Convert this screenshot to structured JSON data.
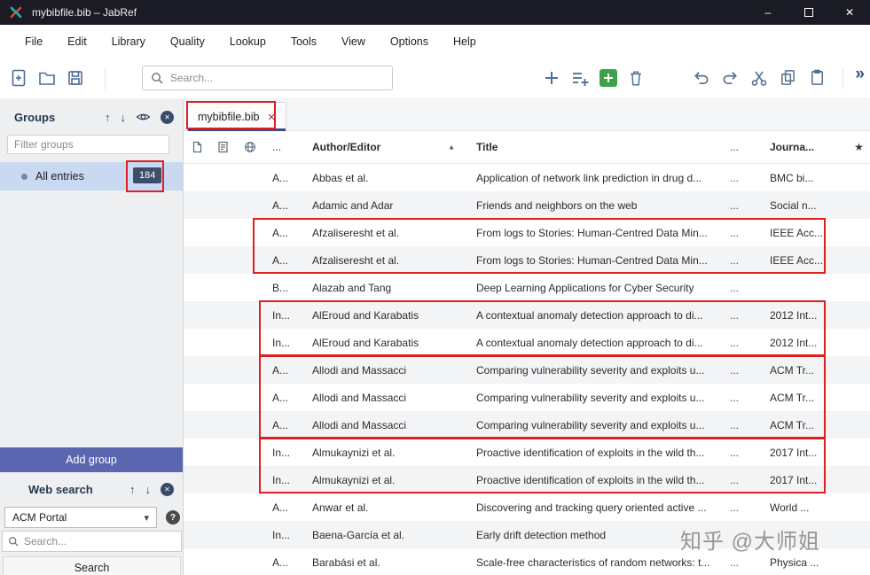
{
  "window": {
    "title": "mybibfile.bib – JabRef"
  },
  "icons": {
    "minimize": "–",
    "close": "✕",
    "help": "?",
    "dropdown": "▾",
    "up": "↑",
    "down": "↓",
    "overflow": "»",
    "sort_asc": "▲",
    "star": "★"
  },
  "menu": {
    "items": [
      "File",
      "Edit",
      "Library",
      "Quality",
      "Lookup",
      "Tools",
      "View",
      "Options",
      "Help"
    ]
  },
  "toolbar": {
    "search_placeholder": "Search..."
  },
  "sidebar": {
    "groups_header": "Groups",
    "filter_placeholder": "Filter groups",
    "all_entries_label": "All entries",
    "all_entries_count": "184",
    "add_group_label": "Add group",
    "web_search_header": "Web search",
    "engine_value": "ACM Portal",
    "search_placeholder": "Search...",
    "search_button_label": "Search"
  },
  "tab": {
    "label": "mybibfile.bib"
  },
  "table": {
    "headers": {
      "entrytype": "...",
      "author": "Author/Editor",
      "title": "Title",
      "dots": "...",
      "journal": "Journa..."
    },
    "rows": [
      {
        "type": "A...",
        "author": "Abbas et al.",
        "title": "Application of network link prediction in drug d...",
        "dots": "...",
        "journal": "BMC bi..."
      },
      {
        "type": "A...",
        "author": "Adamic and Adar",
        "title": "Friends and neighbors on the web",
        "dots": "...",
        "journal": "Social n..."
      },
      {
        "type": "A...",
        "author": "Afzaliseresht et al.",
        "title": "From logs to Stories: Human-Centred Data Min...",
        "dots": "...",
        "journal": "IEEE Acc..."
      },
      {
        "type": "A...",
        "author": "Afzaliseresht et al.",
        "title": "From logs to Stories: Human-Centred Data Min...",
        "dots": "...",
        "journal": "IEEE Acc..."
      },
      {
        "type": "B...",
        "author": "Alazab and Tang",
        "title": "Deep Learning Applications for Cyber Security",
        "dots": "...",
        "journal": ""
      },
      {
        "type": "In...",
        "author": "AlEroud and Karabatis",
        "title": "A contextual anomaly detection approach to di...",
        "dots": "...",
        "journal": "2012 Int..."
      },
      {
        "type": "In...",
        "author": "AlEroud and Karabatis",
        "title": "A contextual anomaly detection approach to di...",
        "dots": "...",
        "journal": "2012 Int..."
      },
      {
        "type": "A...",
        "author": "Allodi and Massacci",
        "title": "Comparing vulnerability severity and exploits u...",
        "dots": "...",
        "journal": "ACM Tr..."
      },
      {
        "type": "A...",
        "author": "Allodi and Massacci",
        "title": "Comparing vulnerability severity and exploits u...",
        "dots": "...",
        "journal": "ACM Tr..."
      },
      {
        "type": "A...",
        "author": "Allodi and Massacci",
        "title": "Comparing vulnerability severity and exploits u...",
        "dots": "...",
        "journal": "ACM Tr..."
      },
      {
        "type": "In...",
        "author": "Almukaynizi et al.",
        "title": "Proactive identification of exploits in the wild th...",
        "dots": "...",
        "journal": "2017 Int..."
      },
      {
        "type": "In...",
        "author": "Almukaynizi et al.",
        "title": "Proactive identification of exploits in the wild th...",
        "dots": "...",
        "journal": "2017 Int..."
      },
      {
        "type": "A...",
        "author": "Anwar et al.",
        "title": "Discovering and tracking query oriented active ...",
        "dots": "...",
        "journal": "World ..."
      },
      {
        "type": "In...",
        "author": "Baena-García et al.",
        "title": "Early drift detection method",
        "dots": "",
        "journal": ""
      },
      {
        "type": "A...",
        "author": "Barabási et al.",
        "title": "Scale-free characteristics of random networks: t...",
        "dots": "...",
        "journal": "Physica ..."
      }
    ]
  },
  "watermark": {
    "text": "知乎 @大师姐"
  }
}
